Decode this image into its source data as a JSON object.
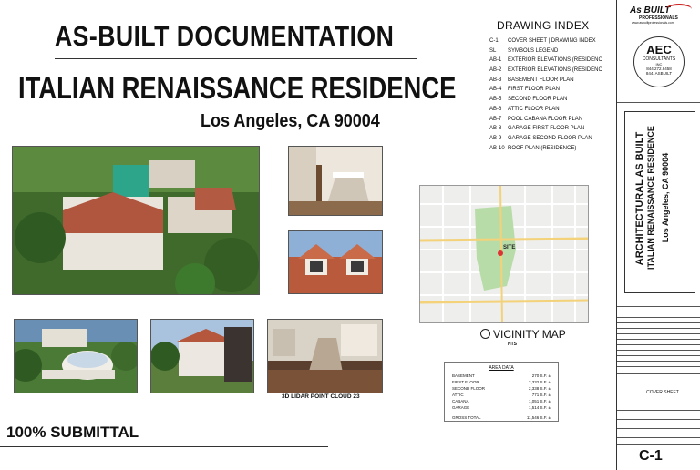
{
  "header": {
    "doc_title": "AS-BUILT DOCUMENTATION",
    "project_name": "ITALIAN RENAISSANCE RESIDENCE",
    "location": "Los Angeles, CA 90004"
  },
  "drawing_index": {
    "title": "DRAWING INDEX",
    "rows": [
      {
        "code": "C-1",
        "name": "COVER SHEET  |  DRAWING INDEX"
      },
      {
        "code": "SL",
        "name": "SYMBOLS LEGEND"
      },
      {
        "code": "AB-1",
        "name": "EXTERIOR ELEVATIONS (RESIDENC"
      },
      {
        "code": "AB-2",
        "name": "EXTERIOR ELEVATIONS (RESIDENC"
      },
      {
        "code": "AB-3",
        "name": "BASEMENT FLOOR PLAN"
      },
      {
        "code": "AB-4",
        "name": "FIRST FLOOR PLAN"
      },
      {
        "code": "AB-5",
        "name": "SECOND FLOOR PLAN"
      },
      {
        "code": "AB-6",
        "name": "ATTIC FLOOR PLAN"
      },
      {
        "code": "AB-7",
        "name": "POOL CABANA FLOOR PLAN"
      },
      {
        "code": "AB-8",
        "name": "GARAGE FIRST FLOOR PLAN"
      },
      {
        "code": "AB-9",
        "name": "GARAGE SECOND FLOOR PLAN"
      },
      {
        "code": "AB-10",
        "name": "ROOF PLAN (RESIDENCE)"
      }
    ]
  },
  "photos": {
    "lidar_caption": "3D LIDAR POINT CLOUD 23"
  },
  "map": {
    "site_label": "SITE",
    "title": "VICINITY MAP",
    "subtitle": "NTS"
  },
  "area_data": {
    "title": "AREA DATA",
    "rows": [
      {
        "label": "BASEMENT",
        "value": "270 S.F. ±"
      },
      {
        "label": "FIRST FLOOR",
        "value": "2,332 S.F. ±"
      },
      {
        "label": "SECOND FLOOR",
        "value": "2,338 S.F. ±"
      },
      {
        "label": "ATTIC",
        "value": "771 S.F. ±"
      },
      {
        "label": "CABANA",
        "value": "1,051 S.F. ±"
      },
      {
        "label": "GARAGE",
        "value": "1,514 S.F. ±"
      }
    ],
    "total_label": "GROSS TOTAL",
    "total_value": "11,546 S.F. ±"
  },
  "submittal": "100% SUBMITTAL",
  "title_block": {
    "logo_text": "As BUILT",
    "logo_sub": "PROFESSIONALS",
    "logo_url": "www.asbuiltprofessionals.com",
    "firm_mark": "AEC",
    "firm_name": "CONSULTANTS",
    "firm_inc": "INC",
    "phone1": "844.272.8458",
    "phone2": "844. ASBUILT",
    "vertical_line1": "ARCHITECTURAL AS BUILT",
    "vertical_line2": "ITALIAN RENAISSANCE RESIDENCE",
    "vertical_location": "Los Angeles, CA 90004",
    "sheet_title": "COVER SHEET",
    "sheet_number": "C-1"
  },
  "colors": {
    "logo_red": "#cc1f1f",
    "map_green": "#b7dca8",
    "map_road": "#f3d27a"
  }
}
